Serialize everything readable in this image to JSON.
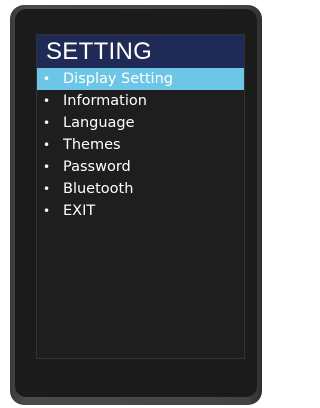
{
  "screen": {
    "title": "SETTING"
  },
  "menu": {
    "bullet": "•",
    "items": [
      {
        "label": "Display Setting",
        "selected": true
      },
      {
        "label": "Information",
        "selected": false
      },
      {
        "label": "Language",
        "selected": false
      },
      {
        "label": "Themes",
        "selected": false
      },
      {
        "label": "Password",
        "selected": false
      },
      {
        "label": "Bluetooth",
        "selected": false
      },
      {
        "label": "EXIT",
        "selected": false
      }
    ]
  },
  "colors": {
    "title_bar": "#1f2a57",
    "selection_highlight": "#6ec6e6",
    "screen_background": "#1e1e1e",
    "text": "#ffffff"
  }
}
